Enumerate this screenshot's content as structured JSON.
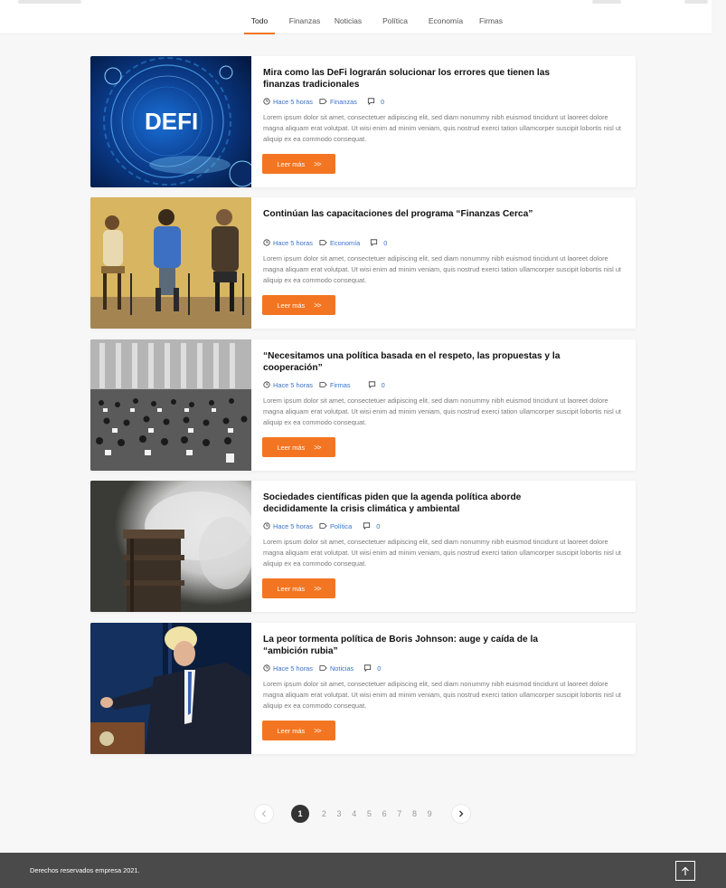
{
  "nav": {
    "tabs": [
      {
        "label": "Todo"
      },
      {
        "label": "Finanzas"
      },
      {
        "label": "Noticias"
      },
      {
        "label": "Política"
      },
      {
        "label": "Economía"
      },
      {
        "label": "Firmas"
      }
    ],
    "active_tab": "Todo",
    "accent_color": "#f37521"
  },
  "articles": [
    {
      "title": "Mira como las DeFi lograrán solucionar los errores que tienen las finanzas tradicionales",
      "time": "Hace 5 horas",
      "category": "Finanzas",
      "comments": "0",
      "image_text": "DEFI",
      "excerpt": "Lorem ipsum dolor sit amet, consectetuer adipiscing elit, sed diam nonummy nibh euismod tincidunt ut laoreet dolore magna aliquam erat volutpat. Ut wisi enim ad minim veniam, quis nostrud exerci tation ullamcorper suscipit lobortis nisl ut aliquip ex ea commodo consequat.",
      "button": "Leer más"
    },
    {
      "title": "Continúan las capacitaciones del programa “Finanzas Cerca”",
      "time": "Hace 5 horas",
      "category": "Economía",
      "comments": "0",
      "excerpt": "Lorem ipsum dolor sit amet, consectetuer adipiscing elit, sed diam nonummy nibh euismod tincidunt ut laoreet dolore magna aliquam erat volutpat. Ut wisi enim ad minim veniam, quis nostrud exerci tation ullamcorper suscipit lobortis nisl ut aliquip ex ea commodo consequat.",
      "button": "Leer más"
    },
    {
      "title": "“Necesitamos una política basada en el respeto, las propuestas y la cooperación”",
      "time": "Hace 5 horas",
      "category": "Firmas",
      "comments": "0",
      "excerpt": "Lorem ipsum dolor sit amet, consectetuer adipiscing elit, sed diam nonummy nibh euismod tincidunt ut laoreet dolore magna aliquam erat volutpat. Ut wisi enim ad minim veniam, quis nostrud exerci tation ullamcorper suscipit lobortis nisl ut aliquip ex ea commodo consequat.",
      "button": "Leer más"
    },
    {
      "title": "Sociedades científicas piden que la agenda política aborde decididamente la crisis climática y ambiental",
      "time": "Hace 5 horas",
      "category": "Política",
      "comments": "0",
      "excerpt": "Lorem ipsum dolor sit amet, consectetuer adipiscing elit, sed diam nonummy nibh euismod tincidunt ut laoreet dolore magna aliquam erat volutpat. Ut wisi enim ad minim veniam, quis nostrud exerci tation ullamcorper suscipit lobortis nisl ut aliquip ex ea commodo consequat.",
      "button": "Leer más"
    },
    {
      "title": "La peor tormenta política de Boris Johnson: auge y caída de la “ambición rubia”",
      "time": "Hace 5 horas",
      "category": "Noticias",
      "comments": "0",
      "excerpt": "Lorem ipsum dolor sit amet, consectetuer adipiscing elit, sed diam nonummy nibh euismod tincidunt ut laoreet dolore magna aliquam erat volutpat. Ut wisi enim ad minim veniam, quis nostrud exerci tation ullamcorper suscipit lobortis nisl ut aliquip ex ea commodo consequat.",
      "button": "Leer más"
    }
  ],
  "pagination": {
    "current": "1",
    "pages": [
      "2",
      "3",
      "4",
      "5",
      "6",
      "7",
      "8",
      "9"
    ],
    "prev_icon": "chevron-left-icon",
    "next_icon": "chevron-right-icon"
  },
  "footer": {
    "copyright": "Derechos reservados empresa 2021.",
    "to_top_icon": "arrow-up-icon"
  }
}
